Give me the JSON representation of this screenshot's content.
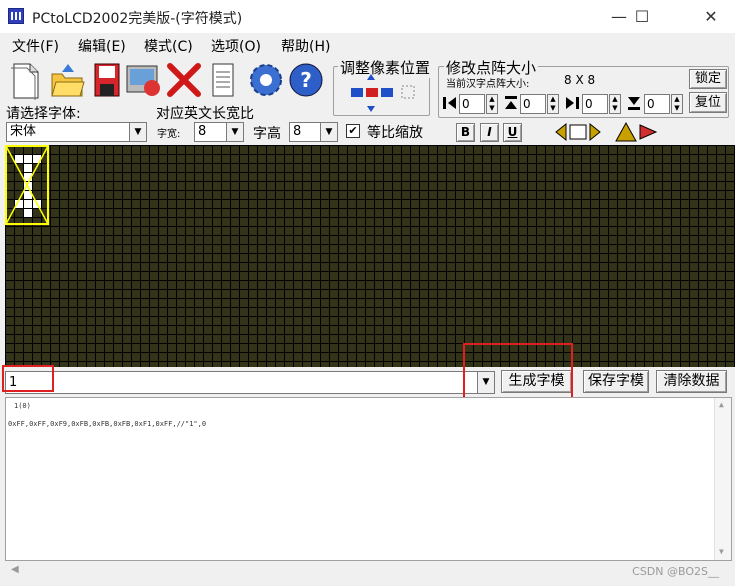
{
  "window": {
    "title": "PCtoLCD2002完美版-(字符模式)"
  },
  "menu": [
    "文件(F)",
    "编辑(E)",
    "模式(C)",
    "选项(O)",
    "帮助(H)"
  ],
  "pixel_adjust": {
    "title": "调整像素位置"
  },
  "matrix_size": {
    "title": "修改点阵大小",
    "current_label": "当前汉字点阵大小:",
    "current_value": "8 X 8",
    "lock_label": "锁定",
    "reset_label": "复位",
    "spin_values": [
      "0",
      "0",
      "0",
      "0"
    ]
  },
  "font": {
    "select_label": "请选择字体:",
    "selected_font": "宋体",
    "width_section_label": "对应英文长宽比",
    "width_label": "字宽:",
    "width_value": "8",
    "height_label": "字高",
    "height_value": "8",
    "proportional_label": "等比缩放",
    "proportional_checked": true,
    "bold_label": "B",
    "italic_label": "I",
    "underline_label": "U"
  },
  "input": {
    "value": "1"
  },
  "buttons": {
    "generate": "生成字模",
    "save": "保存字模",
    "clear": "清除数据"
  },
  "output": {
    "line1": "1(0)",
    "line2": "0xFF,0xFF,0xF9,0xFB,0xFB,0xFB,0xF1,0xFF,//\"1\",0"
  },
  "watermark": "CSDN @BO2S__",
  "colors": {
    "grid_bg": "#33331a",
    "grid_line": "#000000",
    "lit_pixel": "#ffffff",
    "selection": "#ffff00",
    "annotation": "#e02020"
  }
}
